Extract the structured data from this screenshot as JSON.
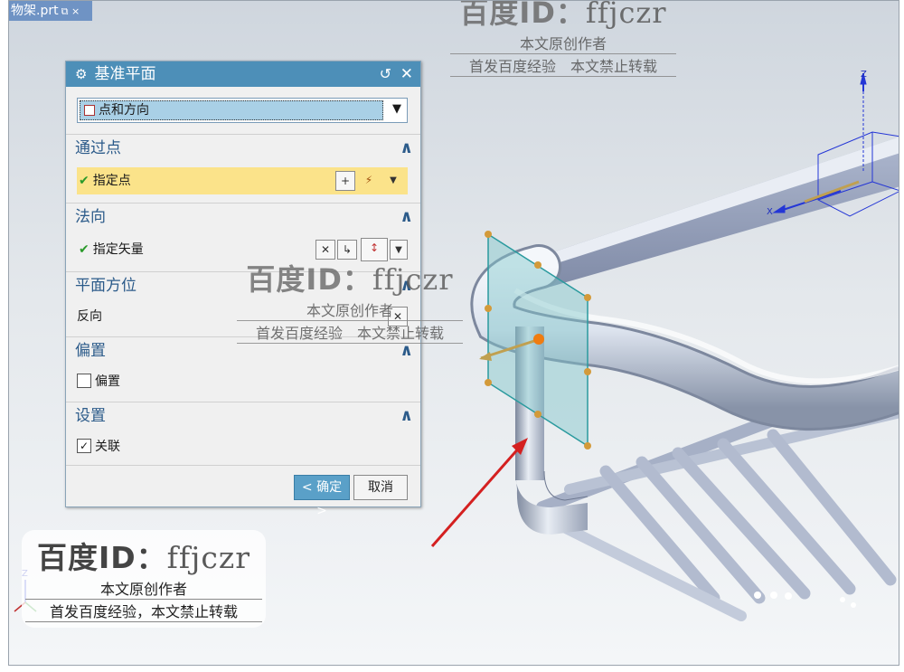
{
  "tab": {
    "title": "物架.prt",
    "icons": "⧉ ×"
  },
  "dialog": {
    "title": "基准平面",
    "reset_icon": "↺",
    "close_icon": "✕",
    "type_value": "点和方向",
    "sections": {
      "through_point": {
        "title": "通过点",
        "row_label": "指定点"
      },
      "normal": {
        "title": "法向",
        "row_label": "指定矢量"
      },
      "plane_orient": {
        "title": "平面方位",
        "row_label": "反向"
      },
      "offset": {
        "title": "偏置",
        "checkbox_label": "偏置",
        "checked": false
      },
      "settings": {
        "title": "设置",
        "checkbox_label": "关联",
        "checked": true
      }
    },
    "ok_label": "< 确定 >",
    "cancel_label": "取消"
  },
  "watermarks": {
    "brand": "百度ID：",
    "handle": "ffjczr",
    "line1": "本文原创作者",
    "line2": "首发百度经验　本文禁止转载",
    "line2_alt": "首发百度经验，本文禁止转载"
  },
  "axes": {
    "z": "Z",
    "x": "X"
  },
  "colors": {
    "dialog_title": "#4d8fb8",
    "highlight": "#fbe38a",
    "section_title": "#2c5b8a",
    "ok_button": "#5aa0c8",
    "arrow": "#d42020"
  }
}
